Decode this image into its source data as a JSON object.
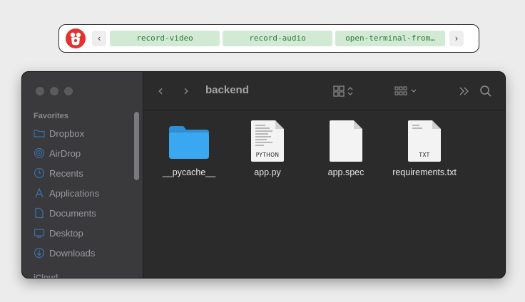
{
  "toolbar": {
    "logo_icon": "app-logo-icon",
    "left_arrow": "‹",
    "right_arrow": "›",
    "chips": [
      "record-video",
      "record-audio",
      "open-terminal-from…"
    ]
  },
  "window": {
    "title": "backend",
    "nav_back": "‹",
    "nav_forward": "›",
    "toolbar_icons": [
      "grid-view-icon",
      "group-icon",
      "chevron-more-icon",
      "search-icon"
    ],
    "sidebar": {
      "heading": "Favorites",
      "items": [
        {
          "label": "Dropbox",
          "icon": "dropbox-folder-icon"
        },
        {
          "label": "AirDrop",
          "icon": "airdrop-icon"
        },
        {
          "label": "Recents",
          "icon": "clock-icon"
        },
        {
          "label": "Applications",
          "icon": "applications-icon"
        },
        {
          "label": "Documents",
          "icon": "document-icon"
        },
        {
          "label": "Desktop",
          "icon": "desktop-icon"
        },
        {
          "label": "Downloads",
          "icon": "download-icon"
        }
      ],
      "next_heading": "iCloud"
    },
    "files": [
      {
        "name": "__pycache__",
        "kind": "folder"
      },
      {
        "name": "app.py",
        "kind": "document",
        "tag": "PYTHON"
      },
      {
        "name": "app.spec",
        "kind": "document",
        "tag": ""
      },
      {
        "name": "requirements.txt",
        "kind": "document",
        "tag": "TXT"
      }
    ]
  },
  "colors": {
    "chip_bg": "#d2ead4",
    "chip_text": "#2f7a3d",
    "folder_blue": "#3aa8f0",
    "window_bg": "#2b2b2b"
  }
}
